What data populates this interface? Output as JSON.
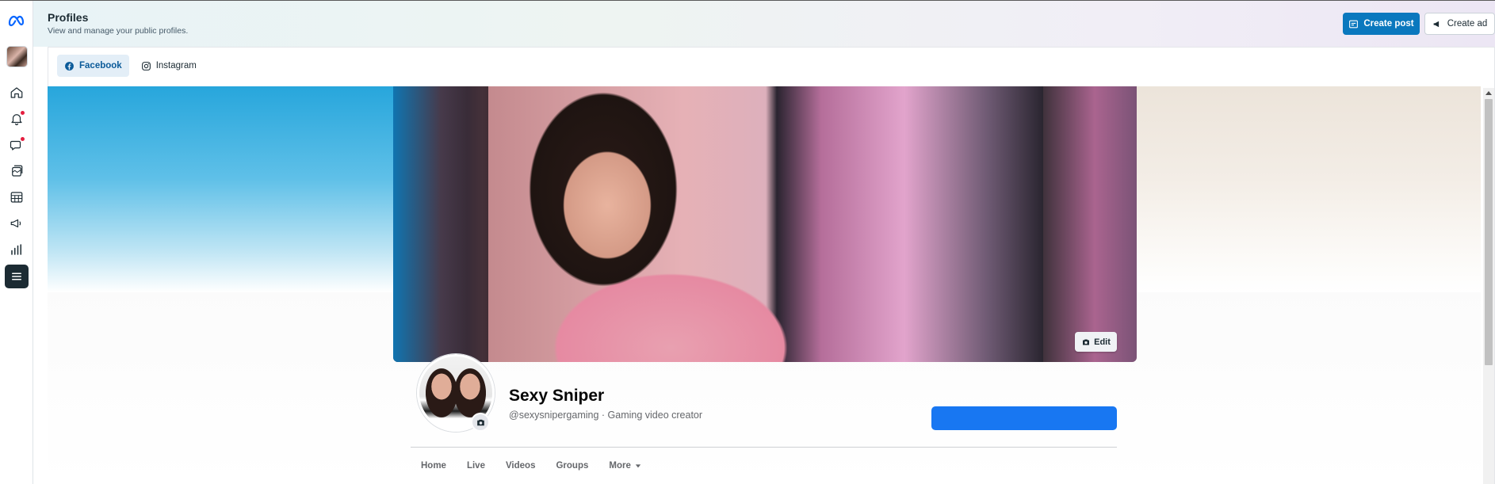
{
  "header": {
    "title": "Profiles",
    "subtitle": "View and manage your public profiles.",
    "create_post_label": "Create post",
    "create_ad_label": "Create ad"
  },
  "tabs": [
    {
      "label": "Facebook",
      "active": true,
      "icon": "facebook-icon"
    },
    {
      "label": "Instagram",
      "active": false,
      "icon": "instagram-icon"
    }
  ],
  "rail": {
    "items": [
      "home-icon",
      "notifications-icon",
      "inbox-icon",
      "content-icon",
      "planner-icon",
      "ads-icon",
      "insights-icon",
      "menu-icon"
    ],
    "notification_badges": [
      "notifications-icon",
      "inbox-icon"
    ]
  },
  "profile": {
    "name": "Sexy Sniper",
    "handle_line": "@sexysnipergaming · Gaming video creator",
    "edit_cover_label": "Edit",
    "nav": [
      "Home",
      "Live",
      "Videos",
      "Groups",
      "More"
    ]
  },
  "colors": {
    "accent": "#0a78be",
    "facebook_blue": "#1877f2",
    "menu_active": "#1c2b33",
    "badge": "#e41e3f"
  }
}
